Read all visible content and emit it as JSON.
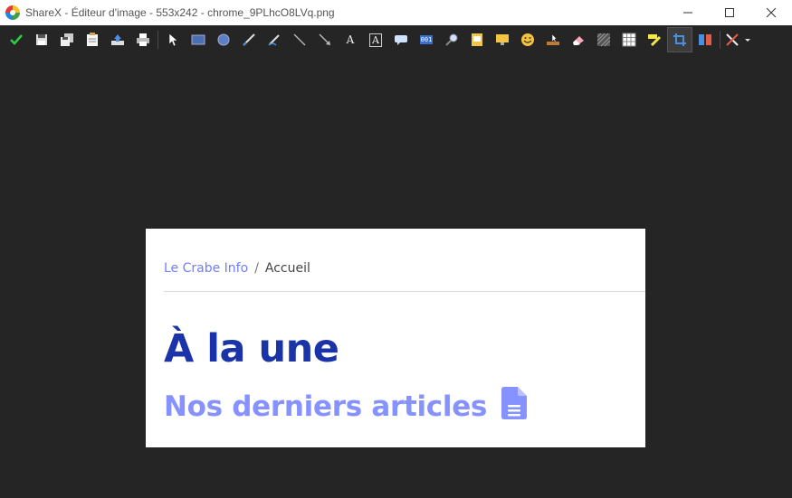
{
  "window": {
    "title": "ShareX - Éditeur d'image - 553x242 - chrome_9PLhcO8LVq.png",
    "app_icon": "sharex-icon",
    "controls": [
      "minimize-icon",
      "maximize-icon",
      "close-icon"
    ]
  },
  "toolbar": {
    "tools": [
      {
        "name": "confirm-icon"
      },
      {
        "name": "save-icon"
      },
      {
        "name": "save-as-icon"
      },
      {
        "name": "copy-icon"
      },
      {
        "name": "upload-icon"
      },
      {
        "name": "print-icon"
      },
      {
        "name": "select-icon"
      },
      {
        "name": "rectangle-icon"
      },
      {
        "name": "ellipse-icon"
      },
      {
        "name": "freehand-icon"
      },
      {
        "name": "smart-eraser-icon"
      },
      {
        "name": "line-icon"
      },
      {
        "name": "arrow-icon"
      },
      {
        "name": "text-outline-icon",
        "glyph": "A"
      },
      {
        "name": "text-background-icon",
        "glyph": "A"
      },
      {
        "name": "speech-balloon-icon"
      },
      {
        "name": "step-icon",
        "glyph": "001"
      },
      {
        "name": "magnify-icon"
      },
      {
        "name": "image-file-icon"
      },
      {
        "name": "image-screen-icon"
      },
      {
        "name": "sticker-icon"
      },
      {
        "name": "cursor-icon"
      },
      {
        "name": "eraser-icon"
      },
      {
        "name": "blur-icon"
      },
      {
        "name": "pixelate-icon"
      },
      {
        "name": "highlight-icon"
      },
      {
        "name": "crop-icon"
      },
      {
        "name": "cut-out-icon"
      },
      {
        "name": "tools-menu-icon"
      }
    ],
    "active_tool": "crop-icon"
  },
  "colors": {
    "background": "#252526",
    "link": "#6f7dff",
    "headline": "#1a33a8",
    "subhead": "#8592ff"
  },
  "document": {
    "breadcrumb": {
      "home": "Le Crabe Info",
      "separator": "/",
      "current": "Accueil"
    },
    "headline": "À la une",
    "subheadline": "Nos derniers articles",
    "subheadline_icon": "file-text-icon"
  }
}
